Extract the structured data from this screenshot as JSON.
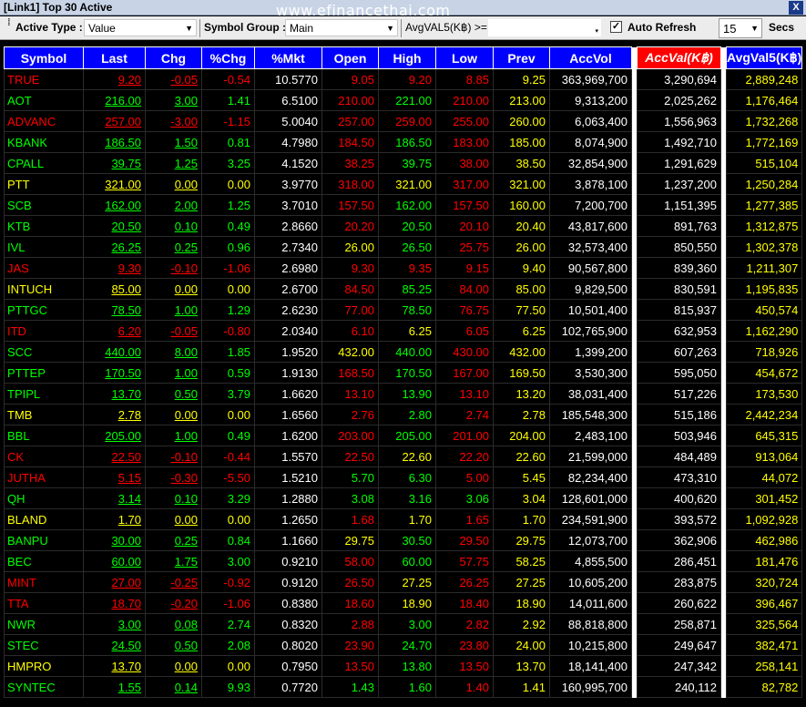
{
  "window": {
    "title": "[Link1] Top 30 Active",
    "watermark": "www.efinancethai.com",
    "close_label": "X"
  },
  "toolbar": {
    "active_type_label": "Active Type :",
    "active_type_value": "Value",
    "symbol_group_label": "Symbol Group :",
    "symbol_group_value": "Main",
    "avgval_label": "AvgVAL5(K฿) >=",
    "auto_refresh_label": "Auto Refresh",
    "auto_refresh_checked": true,
    "refresh_value": "15",
    "secs_label": "Secs"
  },
  "colors": {
    "up": "#00ff00",
    "down": "#ff0000",
    "unchanged": "#ffff00",
    "header_bg": "#0000ff",
    "highlight_header": "#ff0000"
  },
  "table": {
    "columns": [
      "Symbol",
      "Last",
      "Chg",
      "%Chg",
      "%Mkt",
      "Open",
      "High",
      "Low",
      "Prev",
      "AccVol",
      "AccVal(K฿)",
      "AvgVal5(K฿)"
    ],
    "rows": [
      {
        "s": "TRUE",
        "t": "d",
        "last": "9.20",
        "chg": "-0.05",
        "pchg": "-0.54",
        "mkt": "10.5770",
        "open": "9.05",
        "ot": "d",
        "high": "9.20",
        "ht": "d",
        "low": "8.85",
        "lt": "d",
        "prev": "9.25",
        "vol": "363,969,700",
        "val": "3,290,694",
        "avg": "2,889,248"
      },
      {
        "s": "AOT",
        "t": "u",
        "last": "216.00",
        "chg": "3.00",
        "pchg": "1.41",
        "mkt": "6.5100",
        "open": "210.00",
        "ot": "d",
        "high": "221.00",
        "ht": "u",
        "low": "210.00",
        "lt": "d",
        "prev": "213.00",
        "vol": "9,313,200",
        "val": "2,025,262",
        "avg": "1,176,464"
      },
      {
        "s": "ADVANC",
        "t": "d",
        "last": "257.00",
        "chg": "-3.00",
        "pchg": "-1.15",
        "mkt": "5.0040",
        "open": "257.00",
        "ot": "d",
        "high": "259.00",
        "ht": "d",
        "low": "255.00",
        "lt": "d",
        "prev": "260.00",
        "vol": "6,063,400",
        "val": "1,556,963",
        "avg": "1,732,268"
      },
      {
        "s": "KBANK",
        "t": "u",
        "last": "186.50",
        "chg": "1.50",
        "pchg": "0.81",
        "mkt": "4.7980",
        "open": "184.50",
        "ot": "d",
        "high": "186.50",
        "ht": "u",
        "low": "183.00",
        "lt": "d",
        "prev": "185.00",
        "vol": "8,074,900",
        "val": "1,492,710",
        "avg": "1,772,169"
      },
      {
        "s": "CPALL",
        "t": "u",
        "last": "39.75",
        "chg": "1.25",
        "pchg": "3.25",
        "mkt": "4.1520",
        "open": "38.25",
        "ot": "d",
        "high": "39.75",
        "ht": "u",
        "low": "38.00",
        "lt": "d",
        "prev": "38.50",
        "vol": "32,854,900",
        "val": "1,291,629",
        "avg": "515,104"
      },
      {
        "s": "PTT",
        "t": "n",
        "last": "321.00",
        "chg": "0.00",
        "pchg": "0.00",
        "mkt": "3.9770",
        "open": "318.00",
        "ot": "d",
        "high": "321.00",
        "ht": "n",
        "low": "317.00",
        "lt": "d",
        "prev": "321.00",
        "vol": "3,878,100",
        "val": "1,237,200",
        "avg": "1,250,284"
      },
      {
        "s": "SCB",
        "t": "u",
        "last": "162.00",
        "chg": "2.00",
        "pchg": "1.25",
        "mkt": "3.7010",
        "open": "157.50",
        "ot": "d",
        "high": "162.00",
        "ht": "u",
        "low": "157.50",
        "lt": "d",
        "prev": "160.00",
        "vol": "7,200,700",
        "val": "1,151,395",
        "avg": "1,277,385"
      },
      {
        "s": "KTB",
        "t": "u",
        "last": "20.50",
        "chg": "0.10",
        "pchg": "0.49",
        "mkt": "2.8660",
        "open": "20.20",
        "ot": "d",
        "high": "20.50",
        "ht": "u",
        "low": "20.10",
        "lt": "d",
        "prev": "20.40",
        "vol": "43,817,600",
        "val": "891,763",
        "avg": "1,312,875"
      },
      {
        "s": "IVL",
        "t": "u",
        "last": "26.25",
        "chg": "0.25",
        "pchg": "0.96",
        "mkt": "2.7340",
        "open": "26.00",
        "ot": "n",
        "high": "26.50",
        "ht": "u",
        "low": "25.75",
        "lt": "d",
        "prev": "26.00",
        "vol": "32,573,400",
        "val": "850,550",
        "avg": "1,302,378"
      },
      {
        "s": "JAS",
        "t": "d",
        "last": "9.30",
        "chg": "-0.10",
        "pchg": "-1.06",
        "mkt": "2.6980",
        "open": "9.30",
        "ot": "d",
        "high": "9.35",
        "ht": "d",
        "low": "9.15",
        "lt": "d",
        "prev": "9.40",
        "vol": "90,567,800",
        "val": "839,360",
        "avg": "1,211,307"
      },
      {
        "s": "INTUCH",
        "t": "n",
        "last": "85.00",
        "chg": "0.00",
        "pchg": "0.00",
        "mkt": "2.6700",
        "open": "84.50",
        "ot": "d",
        "high": "85.25",
        "ht": "u",
        "low": "84.00",
        "lt": "d",
        "prev": "85.00",
        "vol": "9,829,500",
        "val": "830,591",
        "avg": "1,195,835"
      },
      {
        "s": "PTTGC",
        "t": "u",
        "last": "78.50",
        "chg": "1.00",
        "pchg": "1.29",
        "mkt": "2.6230",
        "open": "77.00",
        "ot": "d",
        "high": "78.50",
        "ht": "u",
        "low": "76.75",
        "lt": "d",
        "prev": "77.50",
        "vol": "10,501,400",
        "val": "815,937",
        "avg": "450,574"
      },
      {
        "s": "ITD",
        "t": "d",
        "last": "6.20",
        "chg": "-0.05",
        "pchg": "-0.80",
        "mkt": "2.0340",
        "open": "6.10",
        "ot": "d",
        "high": "6.25",
        "ht": "n",
        "low": "6.05",
        "lt": "d",
        "prev": "6.25",
        "vol": "102,765,900",
        "val": "632,953",
        "avg": "1,162,290"
      },
      {
        "s": "SCC",
        "t": "u",
        "last": "440.00",
        "chg": "8.00",
        "pchg": "1.85",
        "mkt": "1.9520",
        "open": "432.00",
        "ot": "n",
        "high": "440.00",
        "ht": "u",
        "low": "430.00",
        "lt": "d",
        "prev": "432.00",
        "vol": "1,399,200",
        "val": "607,263",
        "avg": "718,926"
      },
      {
        "s": "PTTEP",
        "t": "u",
        "last": "170.50",
        "chg": "1.00",
        "pchg": "0.59",
        "mkt": "1.9130",
        "open": "168.50",
        "ot": "d",
        "high": "170.50",
        "ht": "u",
        "low": "167.00",
        "lt": "d",
        "prev": "169.50",
        "vol": "3,530,300",
        "val": "595,050",
        "avg": "454,672"
      },
      {
        "s": "TPIPL",
        "t": "u",
        "last": "13.70",
        "chg": "0.50",
        "pchg": "3.79",
        "mkt": "1.6620",
        "open": "13.10",
        "ot": "d",
        "high": "13.90",
        "ht": "u",
        "low": "13.10",
        "lt": "d",
        "prev": "13.20",
        "vol": "38,031,400",
        "val": "517,226",
        "avg": "173,530"
      },
      {
        "s": "TMB",
        "t": "n",
        "last": "2.78",
        "chg": "0.00",
        "pchg": "0.00",
        "mkt": "1.6560",
        "open": "2.76",
        "ot": "d",
        "high": "2.80",
        "ht": "u",
        "low": "2.74",
        "lt": "d",
        "prev": "2.78",
        "vol": "185,548,300",
        "val": "515,186",
        "avg": "2,442,234"
      },
      {
        "s": "BBL",
        "t": "u",
        "last": "205.00",
        "chg": "1.00",
        "pchg": "0.49",
        "mkt": "1.6200",
        "open": "203.00",
        "ot": "d",
        "high": "205.00",
        "ht": "u",
        "low": "201.00",
        "lt": "d",
        "prev": "204.00",
        "vol": "2,483,100",
        "val": "503,946",
        "avg": "645,315"
      },
      {
        "s": "CK",
        "t": "d",
        "last": "22.50",
        "chg": "-0.10",
        "pchg": "-0.44",
        "mkt": "1.5570",
        "open": "22.50",
        "ot": "d",
        "high": "22.60",
        "ht": "n",
        "low": "22.20",
        "lt": "d",
        "prev": "22.60",
        "vol": "21,599,000",
        "val": "484,489",
        "avg": "913,064"
      },
      {
        "s": "JUTHA",
        "t": "d",
        "last": "5.15",
        "chg": "-0.30",
        "pchg": "-5.50",
        "mkt": "1.5210",
        "open": "5.70",
        "ot": "u",
        "high": "6.30",
        "ht": "u",
        "low": "5.00",
        "lt": "d",
        "prev": "5.45",
        "vol": "82,234,400",
        "val": "473,310",
        "avg": "44,072"
      },
      {
        "s": "QH",
        "t": "u",
        "last": "3.14",
        "chg": "0.10",
        "pchg": "3.29",
        "mkt": "1.2880",
        "open": "3.08",
        "ot": "u",
        "high": "3.16",
        "ht": "u",
        "low": "3.06",
        "lt": "u",
        "prev": "3.04",
        "vol": "128,601,000",
        "val": "400,620",
        "avg": "301,452"
      },
      {
        "s": "BLAND",
        "t": "n",
        "last": "1.70",
        "chg": "0.00",
        "pchg": "0.00",
        "mkt": "1.2650",
        "open": "1.68",
        "ot": "d",
        "high": "1.70",
        "ht": "n",
        "low": "1.65",
        "lt": "d",
        "prev": "1.70",
        "vol": "234,591,900",
        "val": "393,572",
        "avg": "1,092,928"
      },
      {
        "s": "BANPU",
        "t": "u",
        "last": "30.00",
        "chg": "0.25",
        "pchg": "0.84",
        "mkt": "1.1660",
        "open": "29.75",
        "ot": "n",
        "high": "30.50",
        "ht": "u",
        "low": "29.50",
        "lt": "d",
        "prev": "29.75",
        "vol": "12,073,700",
        "val": "362,906",
        "avg": "462,986"
      },
      {
        "s": "BEC",
        "t": "u",
        "last": "60.00",
        "chg": "1.75",
        "pchg": "3.00",
        "mkt": "0.9210",
        "open": "58.00",
        "ot": "d",
        "high": "60.00",
        "ht": "u",
        "low": "57.75",
        "lt": "d",
        "prev": "58.25",
        "vol": "4,855,500",
        "val": "286,451",
        "avg": "181,476"
      },
      {
        "s": "MINT",
        "t": "d",
        "last": "27.00",
        "chg": "-0.25",
        "pchg": "-0.92",
        "mkt": "0.9120",
        "open": "26.50",
        "ot": "d",
        "high": "27.25",
        "ht": "n",
        "low": "26.25",
        "lt": "d",
        "prev": "27.25",
        "vol": "10,605,200",
        "val": "283,875",
        "avg": "320,724"
      },
      {
        "s": "TTA",
        "t": "d",
        "last": "18.70",
        "chg": "-0.20",
        "pchg": "-1.06",
        "mkt": "0.8380",
        "open": "18.60",
        "ot": "d",
        "high": "18.90",
        "ht": "n",
        "low": "18.40",
        "lt": "d",
        "prev": "18.90",
        "vol": "14,011,600",
        "val": "260,622",
        "avg": "396,467"
      },
      {
        "s": "NWR",
        "t": "u",
        "last": "3.00",
        "chg": "0.08",
        "pchg": "2.74",
        "mkt": "0.8320",
        "open": "2.88",
        "ot": "d",
        "high": "3.00",
        "ht": "u",
        "low": "2.82",
        "lt": "d",
        "prev": "2.92",
        "vol": "88,818,800",
        "val": "258,871",
        "avg": "325,564"
      },
      {
        "s": "STEC",
        "t": "u",
        "last": "24.50",
        "chg": "0.50",
        "pchg": "2.08",
        "mkt": "0.8020",
        "open": "23.90",
        "ot": "d",
        "high": "24.70",
        "ht": "u",
        "low": "23.80",
        "lt": "d",
        "prev": "24.00",
        "vol": "10,215,800",
        "val": "249,647",
        "avg": "382,471"
      },
      {
        "s": "HMPRO",
        "t": "n",
        "last": "13.70",
        "chg": "0.00",
        "pchg": "0.00",
        "mkt": "0.7950",
        "open": "13.50",
        "ot": "d",
        "high": "13.80",
        "ht": "u",
        "low": "13.50",
        "lt": "d",
        "prev": "13.70",
        "vol": "18,141,400",
        "val": "247,342",
        "avg": "258,141"
      },
      {
        "s": "SYNTEC",
        "t": "u",
        "last": "1.55",
        "chg": "0.14",
        "pchg": "9.93",
        "mkt": "0.7720",
        "open": "1.43",
        "ot": "u",
        "high": "1.60",
        "ht": "u",
        "low": "1.40",
        "lt": "d",
        "prev": "1.41",
        "vol": "160,995,700",
        "val": "240,112",
        "avg": "82,782"
      }
    ]
  }
}
